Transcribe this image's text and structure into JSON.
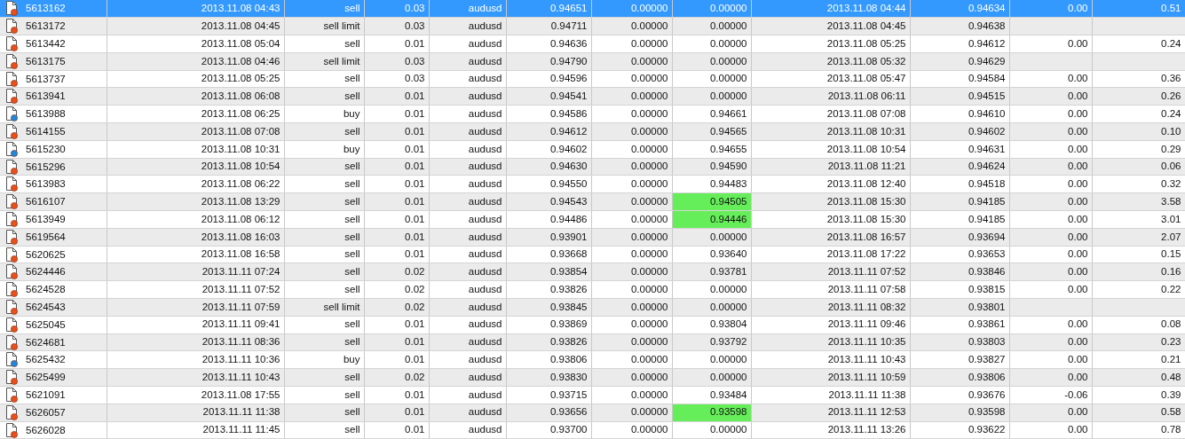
{
  "table": {
    "rows": [
      {
        "kind": "sell",
        "selected": true,
        "highlighted": false,
        "cells": [
          "5613162",
          "2013.11.08 04:43",
          "sell",
          "0.03",
          "audusd",
          "0.94651",
          "0.00000",
          "0.00000",
          "2013.11.08 04:44",
          "0.94634",
          "0.00",
          "0.51"
        ]
      },
      {
        "kind": "sell",
        "selected": false,
        "highlighted": false,
        "cells": [
          "5613172",
          "2013.11.08 04:45",
          "sell limit",
          "0.03",
          "audusd",
          "0.94711",
          "0.00000",
          "0.00000",
          "2013.11.08 04:45",
          "0.94638",
          null,
          null
        ]
      },
      {
        "kind": "sell",
        "selected": false,
        "highlighted": false,
        "cells": [
          "5613442",
          "2013.11.08 05:04",
          "sell",
          "0.01",
          "audusd",
          "0.94636",
          "0.00000",
          "0.00000",
          "2013.11.08 05:25",
          "0.94612",
          "0.00",
          "0.24"
        ]
      },
      {
        "kind": "sell",
        "selected": false,
        "highlighted": false,
        "cells": [
          "5613175",
          "2013.11.08 04:46",
          "sell limit",
          "0.03",
          "audusd",
          "0.94790",
          "0.00000",
          "0.00000",
          "2013.11.08 05:32",
          "0.94629",
          null,
          null
        ]
      },
      {
        "kind": "sell",
        "selected": false,
        "highlighted": false,
        "cells": [
          "5613737",
          "2013.11.08 05:25",
          "sell",
          "0.03",
          "audusd",
          "0.94596",
          "0.00000",
          "0.00000",
          "2013.11.08 05:47",
          "0.94584",
          "0.00",
          "0.36"
        ]
      },
      {
        "kind": "sell",
        "selected": false,
        "highlighted": false,
        "cells": [
          "5613941",
          "2013.11.08 06:08",
          "sell",
          "0.01",
          "audusd",
          "0.94541",
          "0.00000",
          "0.00000",
          "2013.11.08 06:11",
          "0.94515",
          "0.00",
          "0.26"
        ]
      },
      {
        "kind": "buy",
        "selected": false,
        "highlighted": false,
        "cells": [
          "5613988",
          "2013.11.08 06:25",
          "buy",
          "0.01",
          "audusd",
          "0.94586",
          "0.00000",
          "0.94661",
          "2013.11.08 07:08",
          "0.94610",
          "0.00",
          "0.24"
        ]
      },
      {
        "kind": "sell",
        "selected": false,
        "highlighted": false,
        "cells": [
          "5614155",
          "2013.11.08 07:08",
          "sell",
          "0.01",
          "audusd",
          "0.94612",
          "0.00000",
          "0.94565",
          "2013.11.08 10:31",
          "0.94602",
          "0.00",
          "0.10"
        ]
      },
      {
        "kind": "buy",
        "selected": false,
        "highlighted": false,
        "cells": [
          "5615230",
          "2013.11.08 10:31",
          "buy",
          "0.01",
          "audusd",
          "0.94602",
          "0.00000",
          "0.94655",
          "2013.11.08 10:54",
          "0.94631",
          "0.00",
          "0.29"
        ]
      },
      {
        "kind": "sell",
        "selected": false,
        "highlighted": false,
        "cells": [
          "5615296",
          "2013.11.08 10:54",
          "sell",
          "0.01",
          "audusd",
          "0.94630",
          "0.00000",
          "0.94590",
          "2013.11.08 11:21",
          "0.94624",
          "0.00",
          "0.06"
        ]
      },
      {
        "kind": "sell",
        "selected": false,
        "highlighted": false,
        "cells": [
          "5613983",
          "2013.11.08 06:22",
          "sell",
          "0.01",
          "audusd",
          "0.94550",
          "0.00000",
          "0.94483",
          "2013.11.08 12:40",
          "0.94518",
          "0.00",
          "0.32"
        ]
      },
      {
        "kind": "sell",
        "selected": false,
        "highlighted": true,
        "cells": [
          "5616107",
          "2013.11.08 13:29",
          "sell",
          "0.01",
          "audusd",
          "0.94543",
          "0.00000",
          "0.94505",
          "2013.11.08 15:30",
          "0.94185",
          "0.00",
          "3.58"
        ]
      },
      {
        "kind": "sell",
        "selected": false,
        "highlighted": true,
        "cells": [
          "5613949",
          "2013.11.08 06:12",
          "sell",
          "0.01",
          "audusd",
          "0.94486",
          "0.00000",
          "0.94446",
          "2013.11.08 15:30",
          "0.94185",
          "0.00",
          "3.01"
        ]
      },
      {
        "kind": "sell",
        "selected": false,
        "highlighted": false,
        "cells": [
          "5619564",
          "2013.11.08 16:03",
          "sell",
          "0.01",
          "audusd",
          "0.93901",
          "0.00000",
          "0.00000",
          "2013.11.08 16:57",
          "0.93694",
          "0.00",
          "2.07"
        ]
      },
      {
        "kind": "sell",
        "selected": false,
        "highlighted": false,
        "cells": [
          "5620625",
          "2013.11.08 16:58",
          "sell",
          "0.01",
          "audusd",
          "0.93668",
          "0.00000",
          "0.93640",
          "2013.11.08 17:22",
          "0.93653",
          "0.00",
          "0.15"
        ]
      },
      {
        "kind": "sell",
        "selected": false,
        "highlighted": false,
        "cells": [
          "5624446",
          "2013.11.11 07:24",
          "sell",
          "0.02",
          "audusd",
          "0.93854",
          "0.00000",
          "0.93781",
          "2013.11.11 07:52",
          "0.93846",
          "0.00",
          "0.16"
        ]
      },
      {
        "kind": "sell",
        "selected": false,
        "highlighted": false,
        "cells": [
          "5624528",
          "2013.11.11 07:52",
          "sell",
          "0.02",
          "audusd",
          "0.93826",
          "0.00000",
          "0.00000",
          "2013.11.11 07:58",
          "0.93815",
          "0.00",
          "0.22"
        ]
      },
      {
        "kind": "sell",
        "selected": false,
        "highlighted": false,
        "cells": [
          "5624543",
          "2013.11.11 07:59",
          "sell limit",
          "0.02",
          "audusd",
          "0.93845",
          "0.00000",
          "0.00000",
          "2013.11.11 08:32",
          "0.93801",
          null,
          null
        ]
      },
      {
        "kind": "sell",
        "selected": false,
        "highlighted": false,
        "cells": [
          "5625045",
          "2013.11.11 09:41",
          "sell",
          "0.01",
          "audusd",
          "0.93869",
          "0.00000",
          "0.93804",
          "2013.11.11 09:46",
          "0.93861",
          "0.00",
          "0.08"
        ]
      },
      {
        "kind": "sell",
        "selected": false,
        "highlighted": false,
        "cells": [
          "5624681",
          "2013.11.11 08:36",
          "sell",
          "0.01",
          "audusd",
          "0.93826",
          "0.00000",
          "0.93792",
          "2013.11.11 10:35",
          "0.93803",
          "0.00",
          "0.23"
        ]
      },
      {
        "kind": "buy",
        "selected": false,
        "highlighted": false,
        "cells": [
          "5625432",
          "2013.11.11 10:36",
          "buy",
          "0.01",
          "audusd",
          "0.93806",
          "0.00000",
          "0.00000",
          "2013.11.11 10:43",
          "0.93827",
          "0.00",
          "0.21"
        ]
      },
      {
        "kind": "sell",
        "selected": false,
        "highlighted": false,
        "cells": [
          "5625499",
          "2013.11.11 10:43",
          "sell",
          "0.02",
          "audusd",
          "0.93830",
          "0.00000",
          "0.00000",
          "2013.11.11 10:59",
          "0.93806",
          "0.00",
          "0.48"
        ]
      },
      {
        "kind": "sell",
        "selected": false,
        "highlighted": false,
        "cells": [
          "5621091",
          "2013.11.08 17:55",
          "sell",
          "0.01",
          "audusd",
          "0.93715",
          "0.00000",
          "0.93484",
          "2013.11.11 11:38",
          "0.93676",
          "-0.06",
          "0.39"
        ]
      },
      {
        "kind": "sell",
        "selected": false,
        "highlighted": true,
        "cells": [
          "5626057",
          "2013.11.11 11:38",
          "sell",
          "0.01",
          "audusd",
          "0.93656",
          "0.00000",
          "0.93598",
          "2013.11.11 12:53",
          "0.93598",
          "0.00",
          "0.58"
        ]
      },
      {
        "kind": "sell",
        "selected": false,
        "highlighted": false,
        "cells": [
          "5626028",
          "2013.11.11 11:45",
          "sell",
          "0.01",
          "audusd",
          "0.93700",
          "0.00000",
          "0.00000",
          "2013.11.11 13:26",
          "0.93622",
          "0.00",
          "0.78"
        ]
      }
    ]
  }
}
